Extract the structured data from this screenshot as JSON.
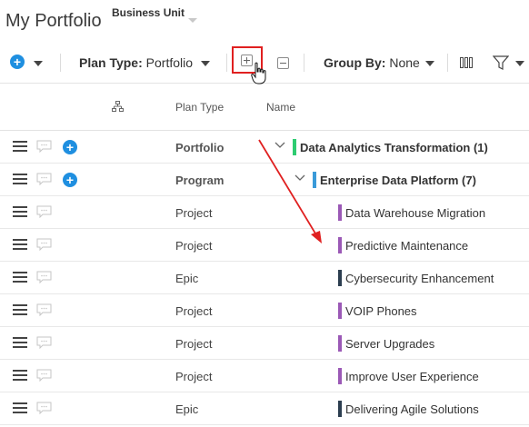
{
  "page": {
    "title": "My Portfolio",
    "business_unit_label": "Business Unit"
  },
  "toolbar": {
    "plan_type_label": "Plan Type:",
    "plan_type_value": "Portfolio",
    "group_by_label": "Group By:",
    "group_by_value": "None",
    "expand_all_icon": "plus-square-icon",
    "collapse_all_icon": "minus-square-icon",
    "columns_icon": "columns-icon",
    "filter_icon": "filter-icon"
  },
  "header": {
    "hierarchy_icon": "hierarchy-icon",
    "col_plan_type": "Plan Type",
    "col_name": "Name"
  },
  "colors": {
    "accent_blue": "#1f8fe0",
    "highlight_red": "#e02020",
    "portfolio_green": "#2ecc71",
    "program_blue": "#3a9ad9",
    "project_purple": "#9b59b6",
    "epic_dark": "#2c3e50"
  },
  "rows": [
    {
      "plan_type": "Portfolio",
      "name": "Data Analytics Transformation (1)",
      "level": 0,
      "expandable": true,
      "has_add": true,
      "color": "#2ecc71"
    },
    {
      "plan_type": "Program",
      "name": "Enterprise Data Platform (7)",
      "level": 1,
      "expandable": true,
      "has_add": true,
      "color": "#3a9ad9"
    },
    {
      "plan_type": "Project",
      "name": "Data Warehouse Migration",
      "level": 2,
      "color": "#9b59b6"
    },
    {
      "plan_type": "Project",
      "name": "Predictive Maintenance",
      "level": 2,
      "color": "#9b59b6"
    },
    {
      "plan_type": "Epic",
      "name": "Cybersecurity Enhancement",
      "level": 2,
      "color": "#2c3e50"
    },
    {
      "plan_type": "Project",
      "name": "VOIP Phones",
      "level": 2,
      "color": "#9b59b6"
    },
    {
      "plan_type": "Project",
      "name": "Server Upgrades",
      "level": 2,
      "color": "#9b59b6"
    },
    {
      "plan_type": "Project",
      "name": "Improve User Experience",
      "level": 2,
      "color": "#9b59b6"
    },
    {
      "plan_type": "Epic",
      "name": "Delivering Agile Solutions",
      "level": 2,
      "color": "#2c3e50"
    }
  ]
}
